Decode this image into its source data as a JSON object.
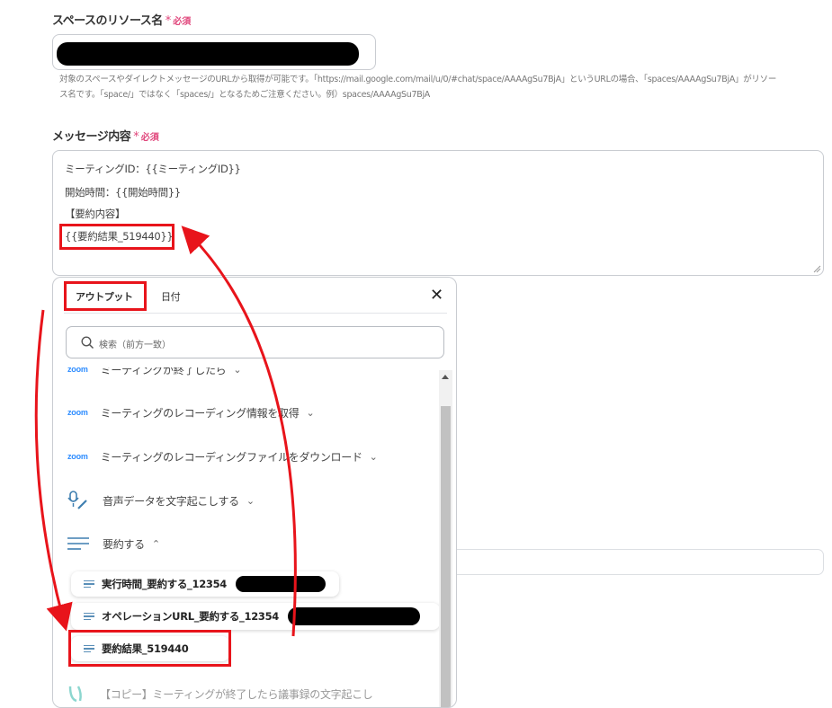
{
  "space_field": {
    "label": "スペースのリソース名",
    "required_star": "*",
    "required_text": "必須",
    "helper_line1": "対象のスペースやダイレクトメッセージのURLから取得が可能です。「https://mail.google.com/mail/u/0/#chat/space/AAAAgSu7BjA」というURLの場合、「spaces/AAAAgSu7BjA」がリソー",
    "helper_line2": "ス名です。「space/」ではなく「spaces/」となるためご注意ください。例）spaces/AAAAgSu7BjA"
  },
  "message_field": {
    "label": "メッセージ内容",
    "required_star": "*",
    "required_text": "必須",
    "lines": [
      "ミーティングID：{{ミーティングID}}",
      "開始時間：{{開始時間}}",
      "【要約内容】",
      "{{要約結果_519440}}"
    ]
  },
  "output_panel": {
    "tabs": [
      "アウトプット",
      "日付"
    ],
    "close_glyph": "✕",
    "search_placeholder": "検索（前方一致）",
    "partial_item": "ミーティングが終了したら",
    "items": [
      {
        "logo": "zoom",
        "label": "ミーティングのレコーディング情報を取得",
        "chevron": "⌄"
      },
      {
        "logo": "zoom",
        "label": "ミーティングのレコーディングファイルをダウンロード",
        "chevron": "⌄"
      },
      {
        "logo": "",
        "label": "音声データを文字起こしする",
        "chevron": "⌄"
      },
      {
        "logo": "",
        "label": "要約する",
        "chevron": "⌃"
      }
    ],
    "sub_items": [
      "実行時間_要約する_12354",
      "オペレーションURL_要約する_12354",
      "要約結果_519440"
    ],
    "bottom_partial": "【コピー】ミーティングが終了したら議事録の文字起こし"
  },
  "colors": {
    "annotation_red": "#e8141b",
    "required_pink": "#e0457b",
    "zoom_blue": "#2d8cff"
  }
}
